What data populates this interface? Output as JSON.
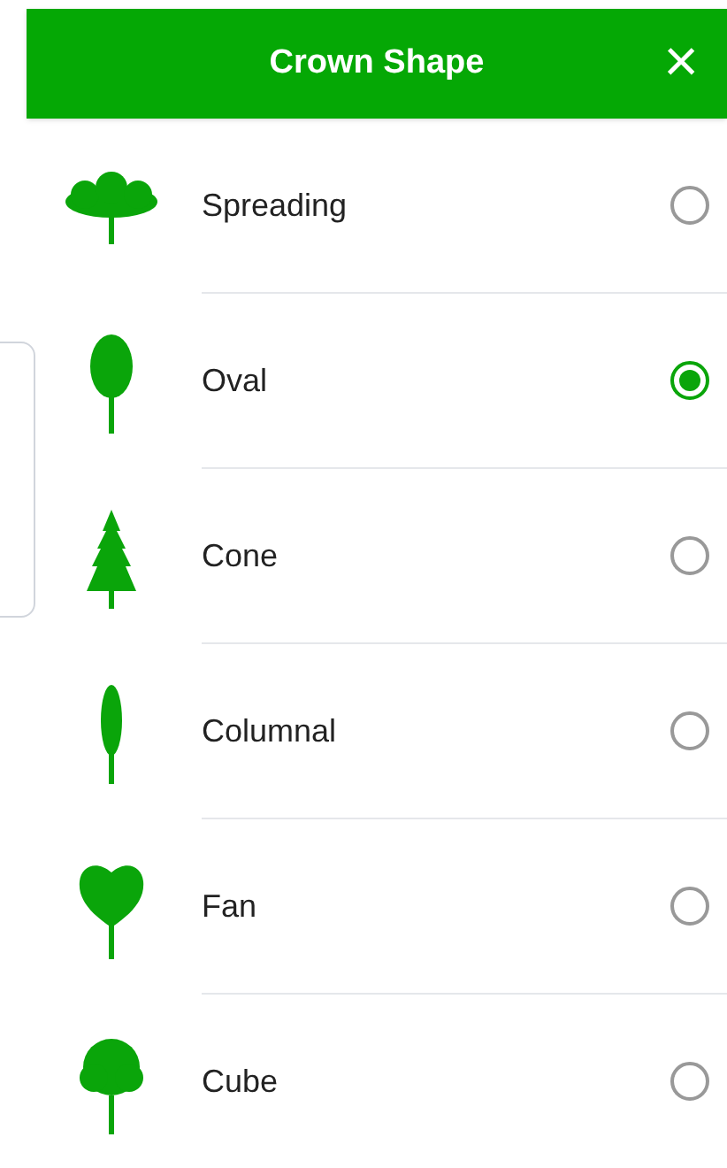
{
  "header": {
    "title": "Crown Shape",
    "close": "×"
  },
  "options": [
    {
      "label": "Spreading",
      "kind": "spreading",
      "selected": false
    },
    {
      "label": "Oval",
      "kind": "oval",
      "selected": true
    },
    {
      "label": "Cone",
      "kind": "cone",
      "selected": false
    },
    {
      "label": "Columnal",
      "kind": "columnal",
      "selected": false
    },
    {
      "label": "Fan",
      "kind": "fan",
      "selected": false
    },
    {
      "label": "Cube",
      "kind": "cube",
      "selected": false
    }
  ]
}
